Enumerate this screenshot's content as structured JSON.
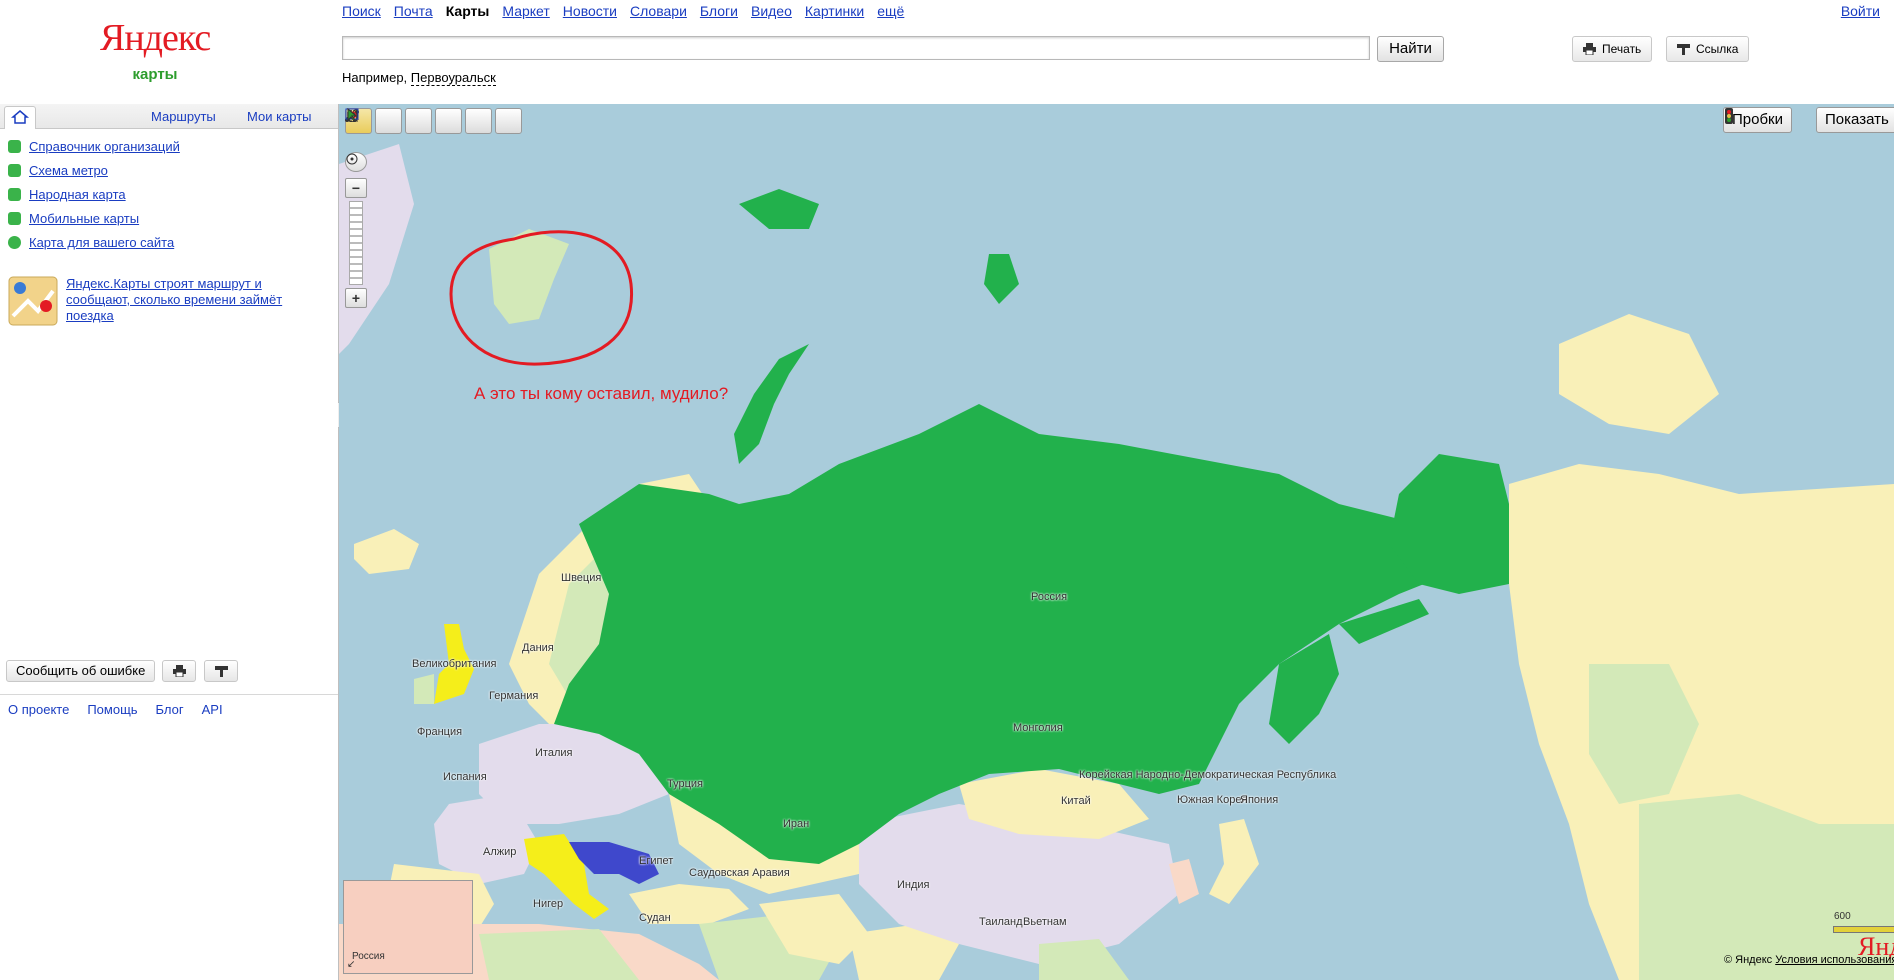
{
  "header": {
    "logo_text": "Яндекс",
    "logo_sub": "карты",
    "services": [
      {
        "label": "Поиск",
        "current": false
      },
      {
        "label": "Почта",
        "current": false
      },
      {
        "label": "Карты",
        "current": true
      },
      {
        "label": "Маркет",
        "current": false
      },
      {
        "label": "Новости",
        "current": false
      },
      {
        "label": "Словари",
        "current": false
      },
      {
        "label": "Блоги",
        "current": false
      },
      {
        "label": "Видео",
        "current": false
      },
      {
        "label": "Картинки",
        "current": false
      },
      {
        "label": "ещё",
        "current": false
      }
    ],
    "login_label": "Войти",
    "search": {
      "value": "",
      "placeholder": "",
      "button_label": "Найти"
    },
    "example_prefix": "Например,",
    "example_link": "Первоуральск",
    "print_label": "Печать",
    "link_label": "Ссылка"
  },
  "left_panel": {
    "tabs": {
      "routes": "Маршруты",
      "my_maps": "Мои карты"
    },
    "items": [
      {
        "label": "Справочник организаций",
        "icon": "directory-icon"
      },
      {
        "label": "Схема метро",
        "icon": "metro-icon"
      },
      {
        "label": "Народная карта",
        "icon": "people-map-icon"
      },
      {
        "label": "Мобильные карты",
        "icon": "mobile-icon"
      },
      {
        "label": "Карта для вашего сайта",
        "icon": "site-map-icon"
      }
    ],
    "promo_text": "Яндекс.Карты строят маршрут и сообщают, сколько времени займёт поездка",
    "report_button": "Сообщить об ошибке",
    "footer_links": [
      "О проекте",
      "Помощь",
      "Блог",
      "API"
    ]
  },
  "map": {
    "traffic_button": "Пробки",
    "show_button": "Показать",
    "annotation": "А это ты кому оставил, мудило?",
    "labels": {
      "russia": "Россия",
      "sweden": "Швеция",
      "denmark": "Дания",
      "uk": "Великобритания",
      "germany": "Германия",
      "france": "Франция",
      "italy": "Италия",
      "spain": "Испания",
      "turkey": "Турция",
      "mongolia": "Монголия",
      "north_korea": "Корейская Народно-Демократическая Республика",
      "china": "Китай",
      "south_korea": "Южная Корея",
      "japan": "Япония",
      "iran": "Иран",
      "algeria": "Алжир",
      "egypt": "Египет",
      "saudi_arabia": "Саудовская Аравия",
      "india": "Индия",
      "niger": "Нигер",
      "sudan": "Судан",
      "thailand": "Таиланд",
      "vietnam": "Вьетнам"
    },
    "minimap_label": "Россия",
    "copyright": "© Яндекс",
    "terms_link": "Условия использования",
    "scale_label": "600",
    "corner_logo": "Янде",
    "colors": {
      "water": "#a9ccdb",
      "russia": "#22b14c",
      "yellow_highlight": "#f5ee1a",
      "blue_highlight": "#3f48cc",
      "annotation": "#e31b23"
    }
  }
}
